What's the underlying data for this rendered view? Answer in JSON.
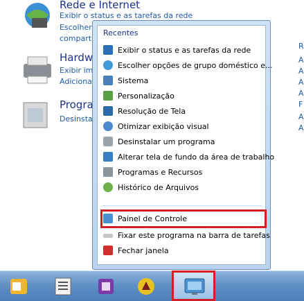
{
  "background": {
    "categories": [
      {
        "title": "Rede e Internet",
        "links": [
          "Exibir o status e as tarefas da rede",
          "Escolher",
          "compart"
        ]
      },
      {
        "title": "Hardw",
        "links": [
          "Exibir imp",
          "Adiciona"
        ]
      },
      {
        "title": "Progra",
        "links": [
          "Desinstal"
        ]
      }
    ],
    "right_letters": [
      "R",
      "A",
      "A",
      "A",
      "A",
      "F",
      "A",
      "A"
    ]
  },
  "jump_list": {
    "header": "Recentes",
    "items": [
      {
        "label": "Exibir o status e as tarefas da rede",
        "icon": "network-icon"
      },
      {
        "label": "Escolher opções de grupo doméstico e...",
        "icon": "homegroup-icon"
      },
      {
        "label": "Sistema",
        "icon": "system-icon"
      },
      {
        "label": "Personalização",
        "icon": "personalization-icon"
      },
      {
        "label": "Resolução de Tela",
        "icon": "display-icon"
      },
      {
        "label": "Otimizar exibição visual",
        "icon": "accessibility-icon"
      },
      {
        "label": "Desinstalar um programa",
        "icon": "programs-icon"
      },
      {
        "label": "Alterar tela de fundo da área de trabalho",
        "icon": "wallpaper-icon"
      },
      {
        "label": "Programas e Recursos",
        "icon": "programs-features-icon"
      },
      {
        "label": "Histórico de Arquivos",
        "icon": "file-history-icon"
      }
    ],
    "pinned_app": "Painel de Controle",
    "pin_task": "Fixar este programa na barra de tarefas",
    "close_window": "Fechar janela"
  },
  "taskbar": {
    "apps": [
      "outlook-icon",
      "word-icon",
      "onenote-icon",
      "filezilla-icon",
      "control-panel-icon"
    ]
  }
}
